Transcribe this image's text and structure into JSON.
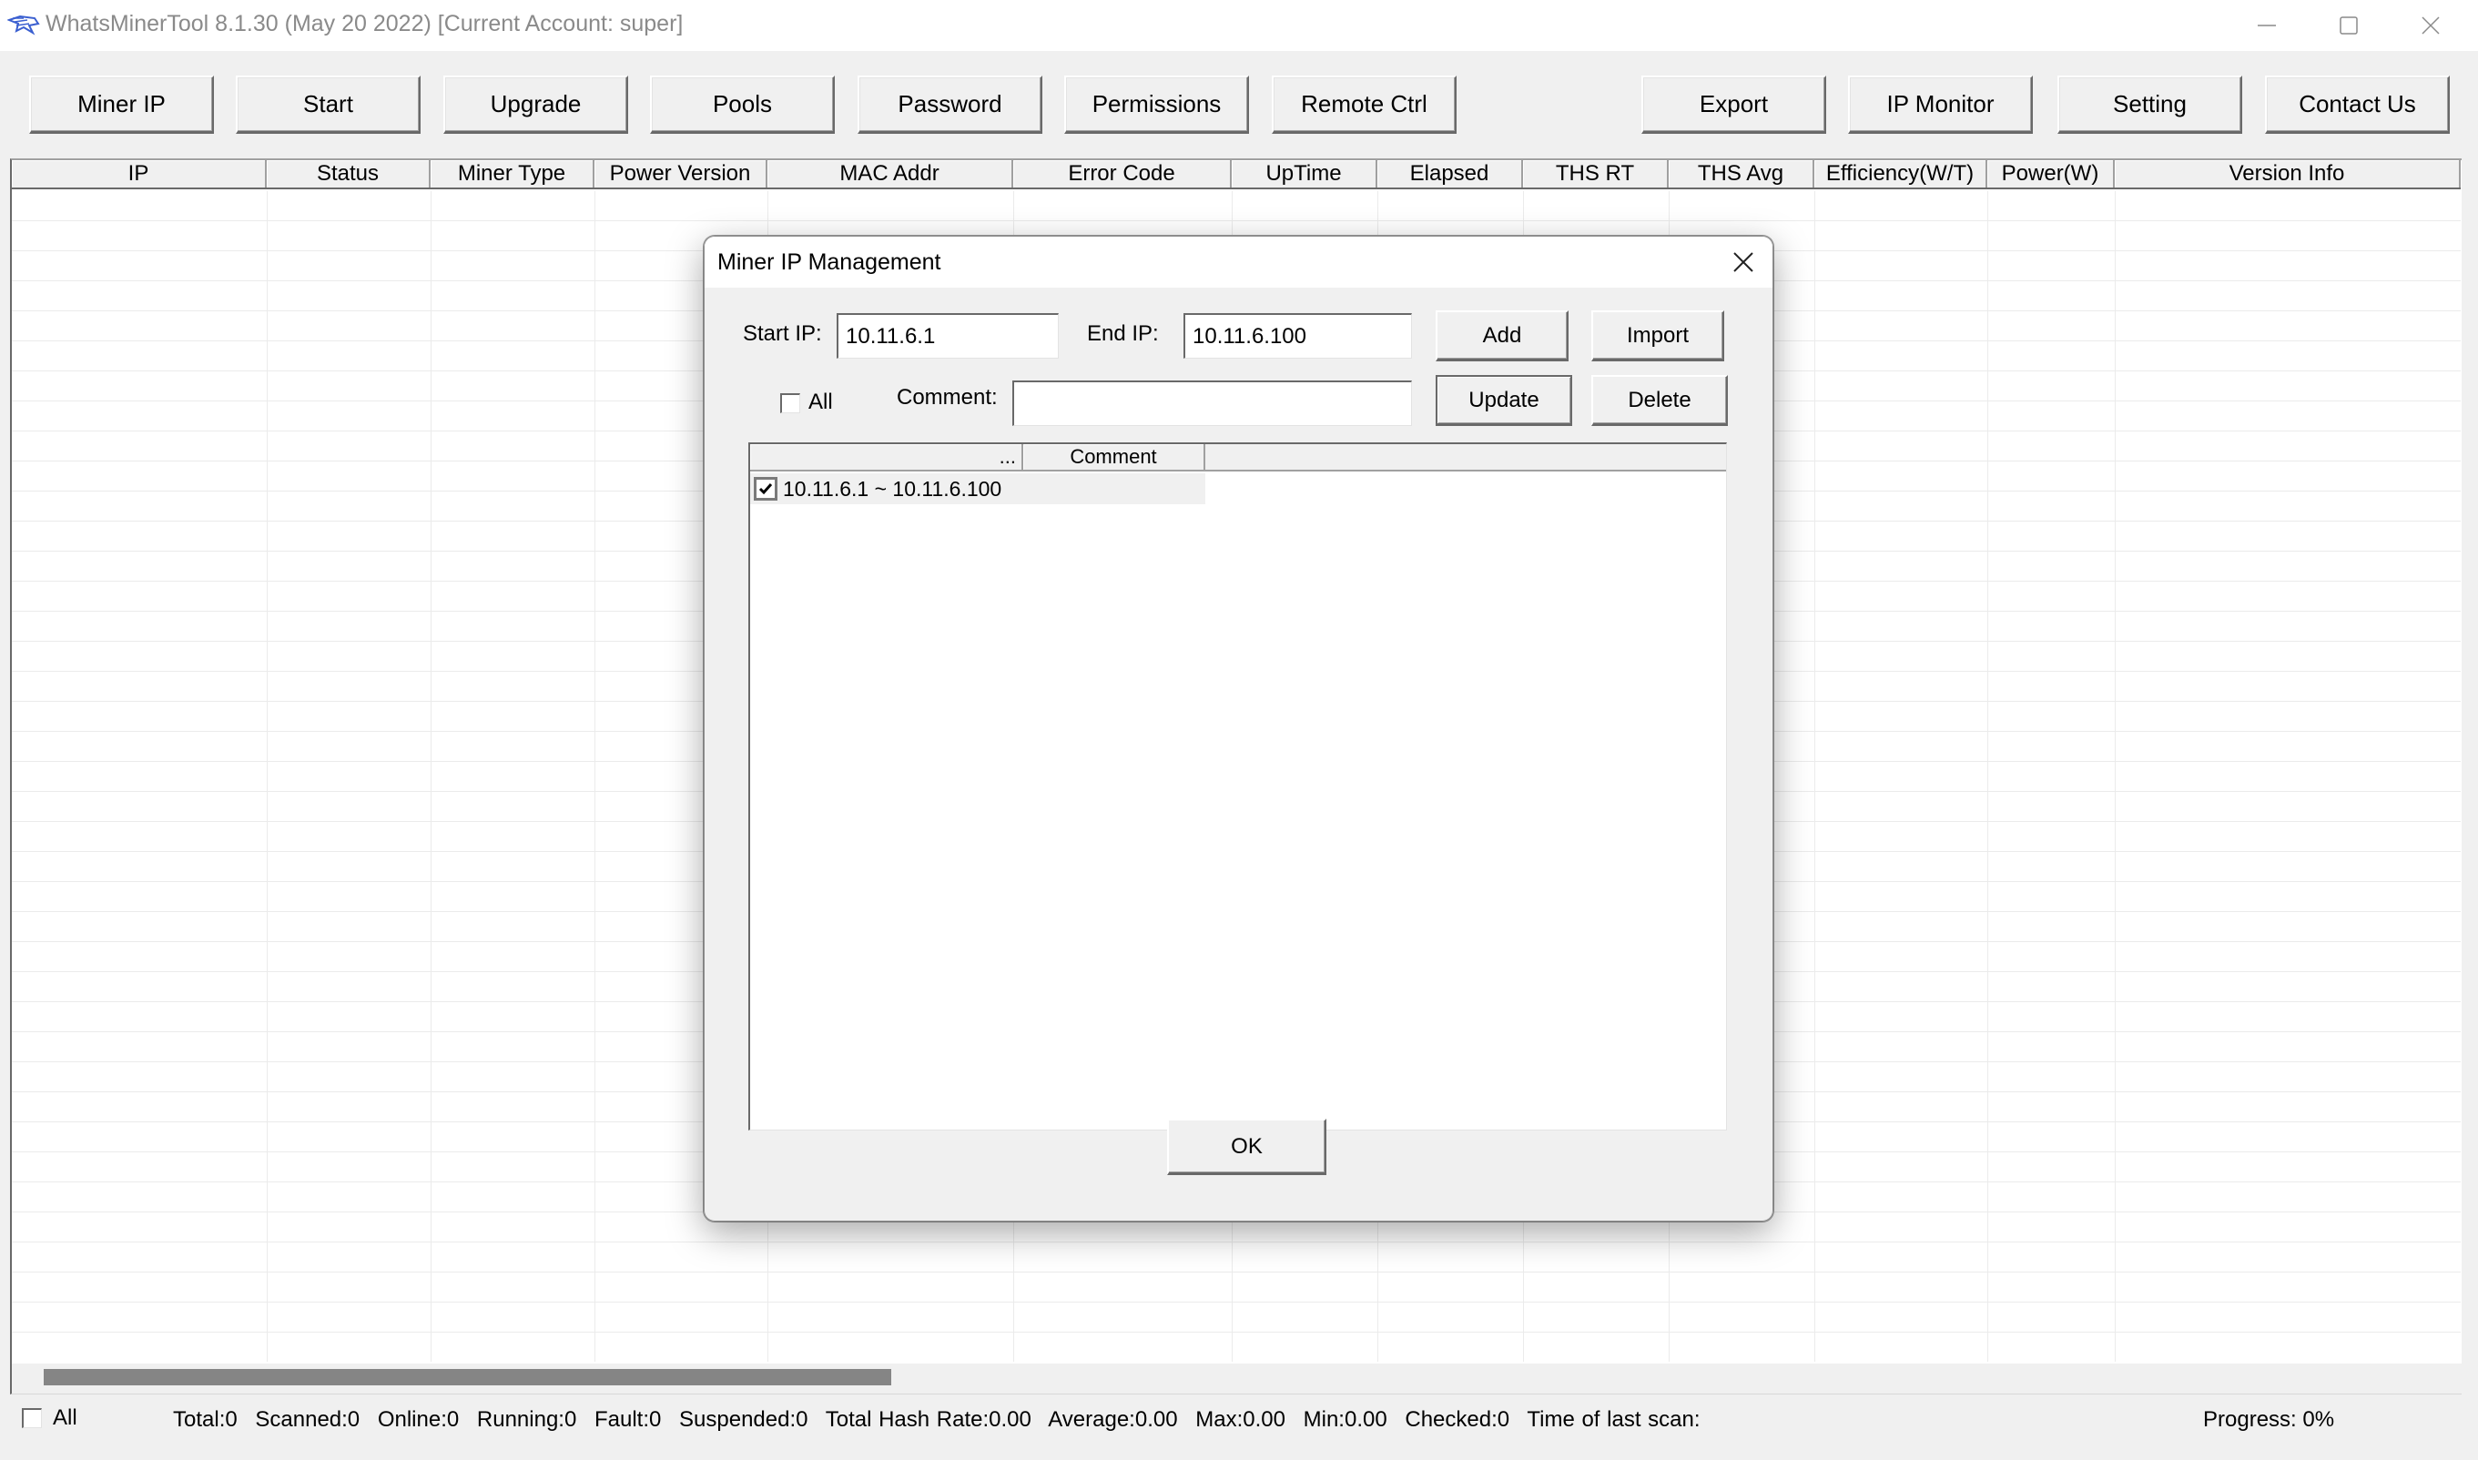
{
  "window": {
    "title": "WhatsMinerTool 8.1.30 (May 20 2022) [Current Account: super]",
    "icon": "whatsminer-logo-icon",
    "controls": [
      "minimize-icon",
      "maximize-icon",
      "close-icon"
    ]
  },
  "toolbar": {
    "left": [
      {
        "label": "Miner IP"
      },
      {
        "label": "Start"
      },
      {
        "label": "Upgrade"
      },
      {
        "label": "Pools"
      },
      {
        "label": "Password"
      },
      {
        "label": "Permissions"
      },
      {
        "label": "Remote Ctrl"
      }
    ],
    "right": [
      {
        "label": "Export"
      },
      {
        "label": "IP Monitor"
      },
      {
        "label": "Setting"
      },
      {
        "label": "Contact Us"
      }
    ]
  },
  "grid": {
    "columns": [
      "IP",
      "Status",
      "Miner Type",
      "Power Version",
      "MAC Addr",
      "Error Code",
      "UpTime",
      "Elapsed",
      "THS RT",
      "THS Avg",
      "Efficiency(W/T)",
      "Power(W)",
      "Version Info"
    ],
    "rows": []
  },
  "statusbar": {
    "all_label": "All",
    "all_checked": false,
    "stats": [
      "Total:0",
      "Scanned:0",
      "Online:0",
      "Running:0",
      "Fault:0",
      "Suspended:0",
      "Total Hash Rate:0.00",
      "Average:0.00",
      "Max:0.00",
      "Min:0.00",
      "Checked:0",
      "Time of last scan:"
    ],
    "progress": "Progress: 0%"
  },
  "dialog": {
    "title": "Miner IP Management",
    "start_ip_label": "Start IP:",
    "start_ip_value": "10.11.6.1",
    "end_ip_label": "End IP:",
    "end_ip_value": "10.11.6.100",
    "all_label": "All",
    "all_checked": false,
    "comment_label": "Comment:",
    "comment_value": "",
    "buttons": {
      "add": "Add",
      "import": "Import",
      "update": "Update",
      "delete": "Delete",
      "ok": "OK"
    },
    "list": {
      "columns": [
        "...",
        "Comment"
      ],
      "rows": [
        {
          "checked": true,
          "range": "10.11.6.1 ~ 10.11.6.100",
          "comment": ""
        }
      ]
    }
  }
}
